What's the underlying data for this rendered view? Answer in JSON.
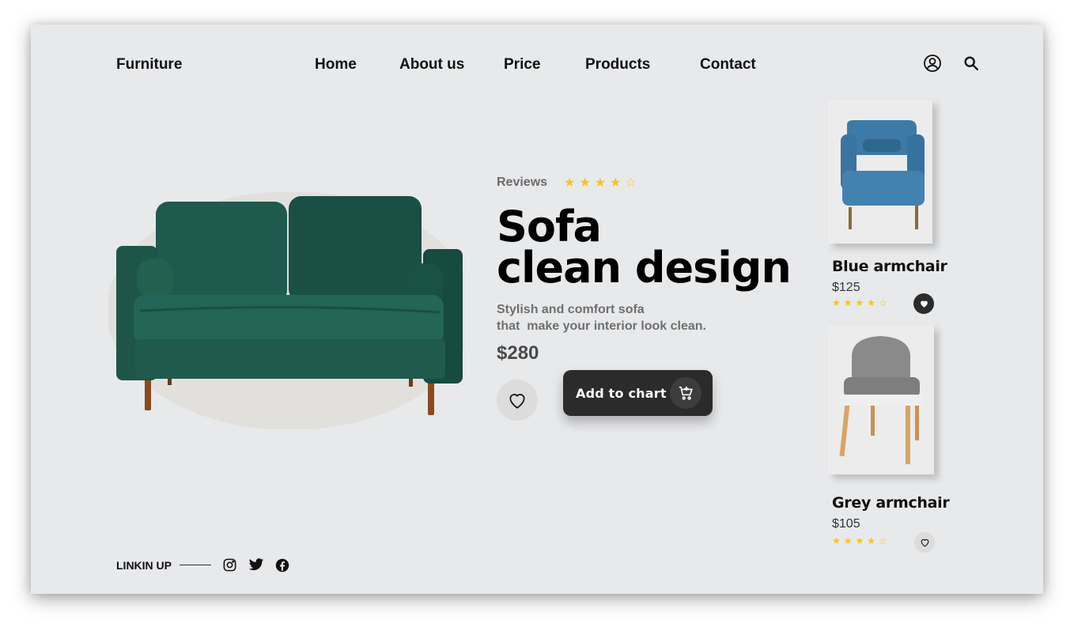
{
  "header": {
    "brand": "Furniture",
    "nav": [
      "Home",
      "About us",
      "Price",
      "Products",
      "Contact"
    ],
    "icons": [
      "user-icon",
      "search-icon"
    ]
  },
  "hero": {
    "reviews_label": "Reviews",
    "rating": 4,
    "rating_max": 5,
    "title_line1": "Sofa",
    "title_line2": "clean design",
    "desc_line1": "Stylish and comfort sofa",
    "desc_line2": "that  make your interior look clean.",
    "price": "$280",
    "cart_label": "Add to chart",
    "colors": {
      "sofa": "#1f5a4f",
      "button": "#2b2b2b",
      "star": "#f5c518",
      "background": "#e8e9eb"
    }
  },
  "products": [
    {
      "name": "Blue armchair",
      "price": "$125",
      "rating": 4,
      "rating_max": 5,
      "favorited": true,
      "color": "#3d7aa8"
    },
    {
      "name": "Grey armchair",
      "price": "$105",
      "rating": 4,
      "rating_max": 5,
      "favorited": false,
      "color": "#8a8a8a"
    }
  ],
  "footer": {
    "label": "LINKIN UP",
    "socials": [
      "instagram-icon",
      "twitter-icon",
      "facebook-icon"
    ]
  }
}
